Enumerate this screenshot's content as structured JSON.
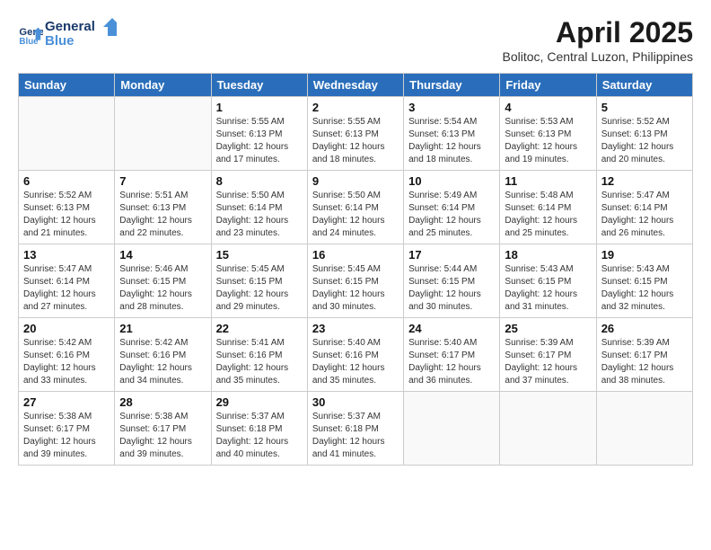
{
  "logo": {
    "line1": "General",
    "line2": "Blue"
  },
  "title": "April 2025",
  "subtitle": "Bolitoc, Central Luzon, Philippines",
  "headers": [
    "Sunday",
    "Monday",
    "Tuesday",
    "Wednesday",
    "Thursday",
    "Friday",
    "Saturday"
  ],
  "weeks": [
    [
      {
        "day": "",
        "sunrise": "",
        "sunset": "",
        "daylight": ""
      },
      {
        "day": "",
        "sunrise": "",
        "sunset": "",
        "daylight": ""
      },
      {
        "day": "1",
        "sunrise": "Sunrise: 5:55 AM",
        "sunset": "Sunset: 6:13 PM",
        "daylight": "Daylight: 12 hours and 17 minutes."
      },
      {
        "day": "2",
        "sunrise": "Sunrise: 5:55 AM",
        "sunset": "Sunset: 6:13 PM",
        "daylight": "Daylight: 12 hours and 18 minutes."
      },
      {
        "day": "3",
        "sunrise": "Sunrise: 5:54 AM",
        "sunset": "Sunset: 6:13 PM",
        "daylight": "Daylight: 12 hours and 18 minutes."
      },
      {
        "day": "4",
        "sunrise": "Sunrise: 5:53 AM",
        "sunset": "Sunset: 6:13 PM",
        "daylight": "Daylight: 12 hours and 19 minutes."
      },
      {
        "day": "5",
        "sunrise": "Sunrise: 5:52 AM",
        "sunset": "Sunset: 6:13 PM",
        "daylight": "Daylight: 12 hours and 20 minutes."
      }
    ],
    [
      {
        "day": "6",
        "sunrise": "Sunrise: 5:52 AM",
        "sunset": "Sunset: 6:13 PM",
        "daylight": "Daylight: 12 hours and 21 minutes."
      },
      {
        "day": "7",
        "sunrise": "Sunrise: 5:51 AM",
        "sunset": "Sunset: 6:13 PM",
        "daylight": "Daylight: 12 hours and 22 minutes."
      },
      {
        "day": "8",
        "sunrise": "Sunrise: 5:50 AM",
        "sunset": "Sunset: 6:14 PM",
        "daylight": "Daylight: 12 hours and 23 minutes."
      },
      {
        "day": "9",
        "sunrise": "Sunrise: 5:50 AM",
        "sunset": "Sunset: 6:14 PM",
        "daylight": "Daylight: 12 hours and 24 minutes."
      },
      {
        "day": "10",
        "sunrise": "Sunrise: 5:49 AM",
        "sunset": "Sunset: 6:14 PM",
        "daylight": "Daylight: 12 hours and 25 minutes."
      },
      {
        "day": "11",
        "sunrise": "Sunrise: 5:48 AM",
        "sunset": "Sunset: 6:14 PM",
        "daylight": "Daylight: 12 hours and 25 minutes."
      },
      {
        "day": "12",
        "sunrise": "Sunrise: 5:47 AM",
        "sunset": "Sunset: 6:14 PM",
        "daylight": "Daylight: 12 hours and 26 minutes."
      }
    ],
    [
      {
        "day": "13",
        "sunrise": "Sunrise: 5:47 AM",
        "sunset": "Sunset: 6:14 PM",
        "daylight": "Daylight: 12 hours and 27 minutes."
      },
      {
        "day": "14",
        "sunrise": "Sunrise: 5:46 AM",
        "sunset": "Sunset: 6:15 PM",
        "daylight": "Daylight: 12 hours and 28 minutes."
      },
      {
        "day": "15",
        "sunrise": "Sunrise: 5:45 AM",
        "sunset": "Sunset: 6:15 PM",
        "daylight": "Daylight: 12 hours and 29 minutes."
      },
      {
        "day": "16",
        "sunrise": "Sunrise: 5:45 AM",
        "sunset": "Sunset: 6:15 PM",
        "daylight": "Daylight: 12 hours and 30 minutes."
      },
      {
        "day": "17",
        "sunrise": "Sunrise: 5:44 AM",
        "sunset": "Sunset: 6:15 PM",
        "daylight": "Daylight: 12 hours and 30 minutes."
      },
      {
        "day": "18",
        "sunrise": "Sunrise: 5:43 AM",
        "sunset": "Sunset: 6:15 PM",
        "daylight": "Daylight: 12 hours and 31 minutes."
      },
      {
        "day": "19",
        "sunrise": "Sunrise: 5:43 AM",
        "sunset": "Sunset: 6:15 PM",
        "daylight": "Daylight: 12 hours and 32 minutes."
      }
    ],
    [
      {
        "day": "20",
        "sunrise": "Sunrise: 5:42 AM",
        "sunset": "Sunset: 6:16 PM",
        "daylight": "Daylight: 12 hours and 33 minutes."
      },
      {
        "day": "21",
        "sunrise": "Sunrise: 5:42 AM",
        "sunset": "Sunset: 6:16 PM",
        "daylight": "Daylight: 12 hours and 34 minutes."
      },
      {
        "day": "22",
        "sunrise": "Sunrise: 5:41 AM",
        "sunset": "Sunset: 6:16 PM",
        "daylight": "Daylight: 12 hours and 35 minutes."
      },
      {
        "day": "23",
        "sunrise": "Sunrise: 5:40 AM",
        "sunset": "Sunset: 6:16 PM",
        "daylight": "Daylight: 12 hours and 35 minutes."
      },
      {
        "day": "24",
        "sunrise": "Sunrise: 5:40 AM",
        "sunset": "Sunset: 6:17 PM",
        "daylight": "Daylight: 12 hours and 36 minutes."
      },
      {
        "day": "25",
        "sunrise": "Sunrise: 5:39 AM",
        "sunset": "Sunset: 6:17 PM",
        "daylight": "Daylight: 12 hours and 37 minutes."
      },
      {
        "day": "26",
        "sunrise": "Sunrise: 5:39 AM",
        "sunset": "Sunset: 6:17 PM",
        "daylight": "Daylight: 12 hours and 38 minutes."
      }
    ],
    [
      {
        "day": "27",
        "sunrise": "Sunrise: 5:38 AM",
        "sunset": "Sunset: 6:17 PM",
        "daylight": "Daylight: 12 hours and 39 minutes."
      },
      {
        "day": "28",
        "sunrise": "Sunrise: 5:38 AM",
        "sunset": "Sunset: 6:17 PM",
        "daylight": "Daylight: 12 hours and 39 minutes."
      },
      {
        "day": "29",
        "sunrise": "Sunrise: 5:37 AM",
        "sunset": "Sunset: 6:18 PM",
        "daylight": "Daylight: 12 hours and 40 minutes."
      },
      {
        "day": "30",
        "sunrise": "Sunrise: 5:37 AM",
        "sunset": "Sunset: 6:18 PM",
        "daylight": "Daylight: 12 hours and 41 minutes."
      },
      {
        "day": "",
        "sunrise": "",
        "sunset": "",
        "daylight": ""
      },
      {
        "day": "",
        "sunrise": "",
        "sunset": "",
        "daylight": ""
      },
      {
        "day": "",
        "sunrise": "",
        "sunset": "",
        "daylight": ""
      }
    ]
  ]
}
